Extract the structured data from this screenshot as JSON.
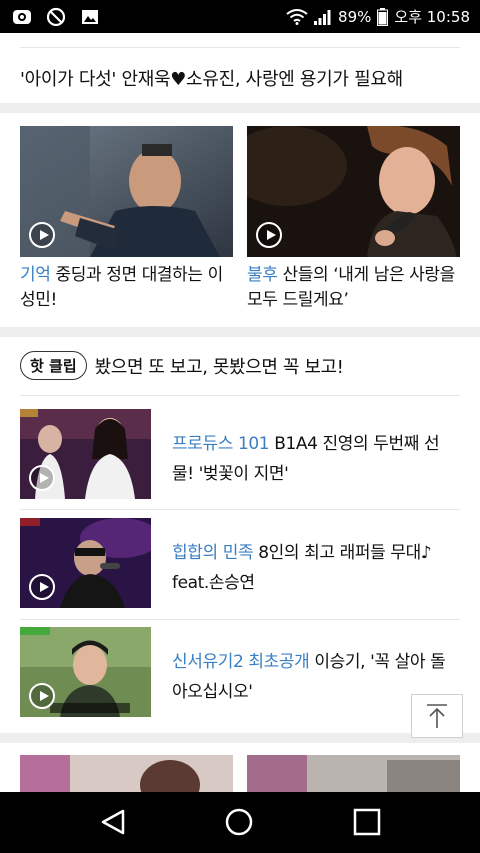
{
  "status_bar": {
    "icons_left": [
      "gallery-app-icon",
      "do-not-disturb-icon",
      "image-icon"
    ],
    "battery_percent": "89%",
    "time": "오후 10:58"
  },
  "headline": "'아이가 다섯' 안재욱♥소유진, 사랑엔 용기가 필요해",
  "video_cards": [
    {
      "keyword": "기억",
      "title_rest": " 중딩과 정면 대결하는 이성민!"
    },
    {
      "keyword": "불후",
      "title_rest": " 산들의 ‘내게 남은 사랑을 모두 드릴게요’"
    }
  ],
  "hot_clip": {
    "badge": "핫 클립",
    "tagline": "봤으면 또 보고, 못봤으면 꼭 보고!"
  },
  "hot_items": [
    {
      "keyword": "프로듀스 101",
      "title_rest": "  B1A4 진영의 두번째 선물! '벚꽃이 지면'"
    },
    {
      "keyword": "힙합의 민족",
      "title_rest": "  8인의 최고 래퍼들 무대♪ feat.손승연"
    },
    {
      "keyword": "신서유기2 최초공개",
      "title_rest": "  이승기, '꼭 살아 돌아오십시오'"
    }
  ],
  "colors": {
    "keyword": "#3a7fc3",
    "status_bar_bg": "#000000",
    "nav_bar_bg": "#000000",
    "band": "#eeeeee"
  }
}
